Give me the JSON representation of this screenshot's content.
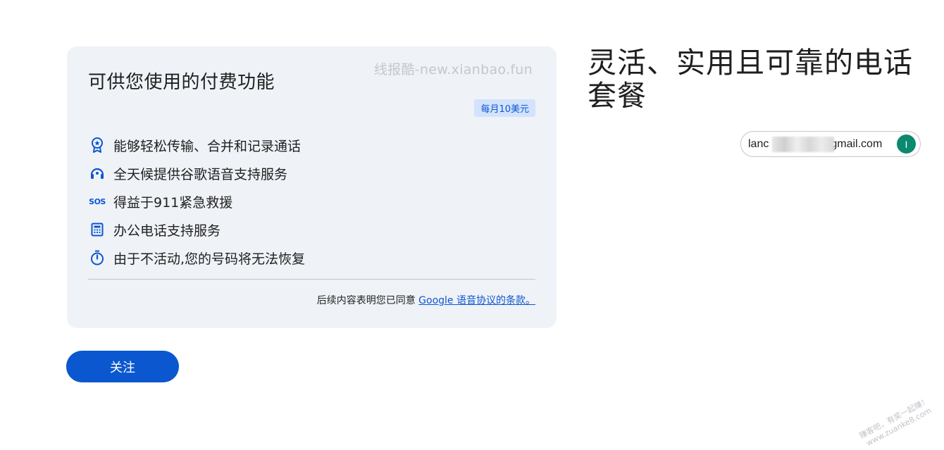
{
  "card": {
    "title": "可供您使用的付费功能",
    "watermark": "线报酷-new.xianbao.fun",
    "price_badge": "每月10美元",
    "features": [
      {
        "icon": "award-badge-icon",
        "label": "能够轻松传输、合并和记录通话"
      },
      {
        "icon": "support-headset-icon",
        "label": "全天候提供谷歌语音支持服务"
      },
      {
        "icon": "sos-icon",
        "icon_text": "SOS",
        "label": "得益于911紧急救援"
      },
      {
        "icon": "office-phone-icon",
        "label": "办公电话支持服务"
      },
      {
        "icon": "timer-icon",
        "label": "由于不活动,您的号码将无法恢复"
      }
    ],
    "terms_prefix": "后续内容表明您已同意",
    "terms_link": "Google 语音协议的条款。"
  },
  "follow_button": "关注",
  "headline": "灵活、实用且可靠的电话套餐",
  "account": {
    "email_prefix": "lanc",
    "email_suffix": "gmail.com",
    "avatar_letter": "I"
  },
  "corner_watermark": {
    "line1": "赚客吧，有奖一起赚！",
    "line2": "www.zuanke8.com"
  },
  "colors": {
    "accent": "#0b57d0",
    "card_bg": "#eff2f7",
    "badge_bg": "#d3e3fd",
    "avatar_bg": "#0b8a6f"
  }
}
